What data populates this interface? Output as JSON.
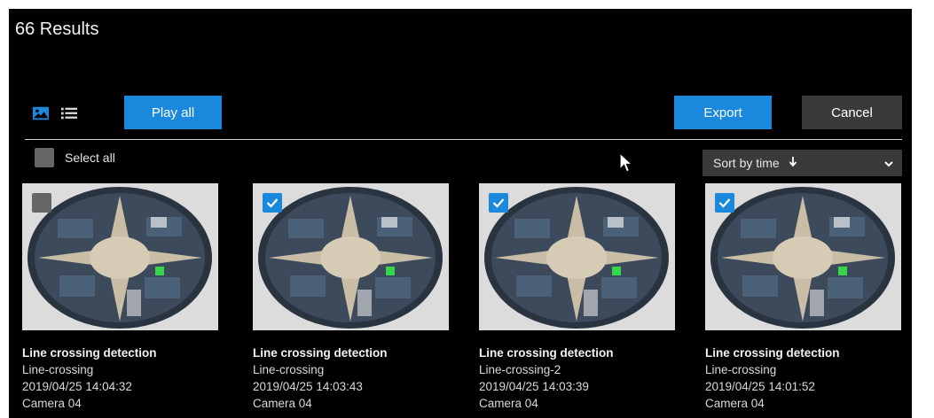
{
  "header": {
    "results_title": "66 Results"
  },
  "toolbar": {
    "grid_view_icon": "image-icon",
    "list_view_icon": "list-icon",
    "play_all_label": "Play all",
    "export_label": "Export",
    "cancel_label": "Cancel"
  },
  "selection": {
    "select_all_label": "Select all",
    "select_all_checked": false
  },
  "sort": {
    "label": "Sort by time",
    "direction_icon": "arrow-down-icon",
    "dropdown_icon": "chevron-down-icon"
  },
  "colors": {
    "accent": "#1a88dc",
    "background": "#000000",
    "secondary_button": "#3a3a3a"
  },
  "results": [
    {
      "checked": false,
      "title": "Line crossing detection",
      "rule": "Line-crossing",
      "timestamp": "2019/04/25 14:04:32",
      "camera": "Camera 04"
    },
    {
      "checked": true,
      "title": "Line crossing detection",
      "rule": "Line-crossing",
      "timestamp": "2019/04/25 14:03:43",
      "camera": "Camera 04"
    },
    {
      "checked": true,
      "title": "Line crossing detection",
      "rule": "Line-crossing-2",
      "timestamp": "2019/04/25 14:03:39",
      "camera": "Camera 04"
    },
    {
      "checked": true,
      "title": "Line crossing detection",
      "rule": "Line-crossing",
      "timestamp": "2019/04/25 14:01:52",
      "camera": "Camera 04"
    }
  ]
}
